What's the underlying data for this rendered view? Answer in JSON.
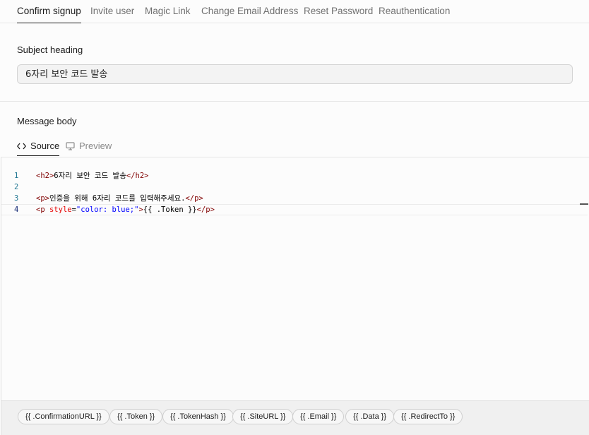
{
  "tabs": [
    "Confirm signup",
    "Invite user",
    "Magic Link",
    "Change Email Address",
    "Reset Password",
    "Reauthentication"
  ],
  "subject": {
    "label": "Subject heading",
    "value": "6자리 보안 코드 발송"
  },
  "message": {
    "label": "Message body",
    "source_tab": "Source",
    "preview_tab": "Preview"
  },
  "editor": {
    "line_numbers": [
      "1",
      "2",
      "3",
      "4"
    ],
    "line1": {
      "open": "<h2>",
      "text": "6자리 보안 코드 발송",
      "close": "</h2>"
    },
    "line3": {
      "open": "<p>",
      "text": "인증을 위해 6자리 코드를 입력해주세요.",
      "close": "</p>"
    },
    "line4": {
      "open_start": "<p",
      "attr_name": " style",
      "eq": "=",
      "attr_value": "\"color: blue;\"",
      "open_end": ">",
      "text": "{{ .Token }}",
      "close": "</p>"
    }
  },
  "variables": [
    "{{ .ConfirmationURL }}",
    "{{ .Token }}",
    "{{ .TokenHash }}",
    "{{ .SiteURL }}",
    "{{ .Email }}",
    "{{ .Data }}",
    "{{ .RedirectTo }}"
  ]
}
